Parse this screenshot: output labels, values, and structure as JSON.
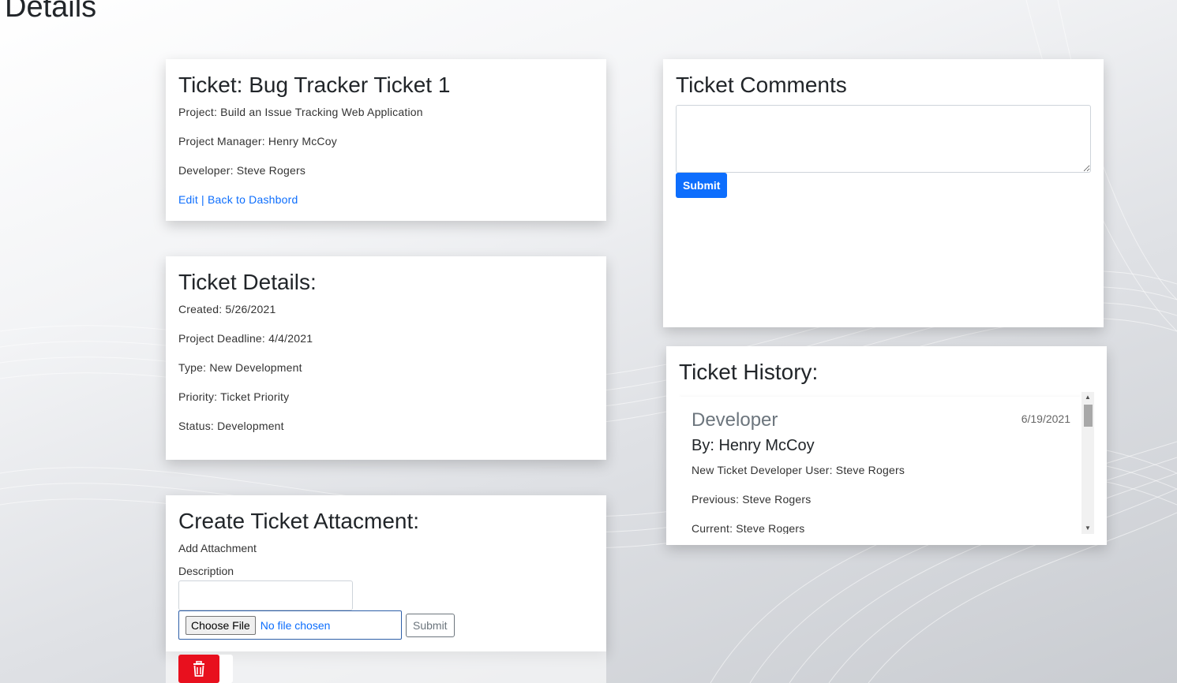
{
  "page": {
    "title": "Details"
  },
  "ticket": {
    "heading": "Ticket: Bug Tracker Ticket 1",
    "project": "Project: Build an Issue Tracking Web Application",
    "manager": "Project Manager: Henry McCoy",
    "developer": "Developer: Steve Rogers",
    "edit_label": "Edit",
    "separator": " | ",
    "back_label": "Back to Dashbord"
  },
  "details": {
    "heading": "Ticket Details:",
    "created": "Created: 5/26/2021",
    "deadline": "Project Deadline: 4/4/2021",
    "type": "Type: New Development",
    "priority": "Priority: Ticket Priority",
    "status": "Status: Development"
  },
  "attachment": {
    "heading": "Create Ticket Attacment:",
    "add_label": "Add Attachment",
    "description_label": "Description",
    "choose_file_label": "Choose File",
    "file_status": "No file chosen",
    "submit_label": "Submit",
    "delete_icon": "trash-icon"
  },
  "comments": {
    "heading": "Ticket Comments",
    "submit_label": "Submit"
  },
  "history": {
    "heading": "Ticket History:",
    "entries": [
      {
        "role": "Developer",
        "date": "6/19/2021",
        "by": "By: Henry McCoy",
        "description": "New Ticket Developer User: Steve Rogers",
        "previous": "Previous: Steve Rogers",
        "current": "Current: Steve Rogers"
      }
    ]
  },
  "colors": {
    "primary": "#0d6efd",
    "danger": "#e8101e"
  }
}
